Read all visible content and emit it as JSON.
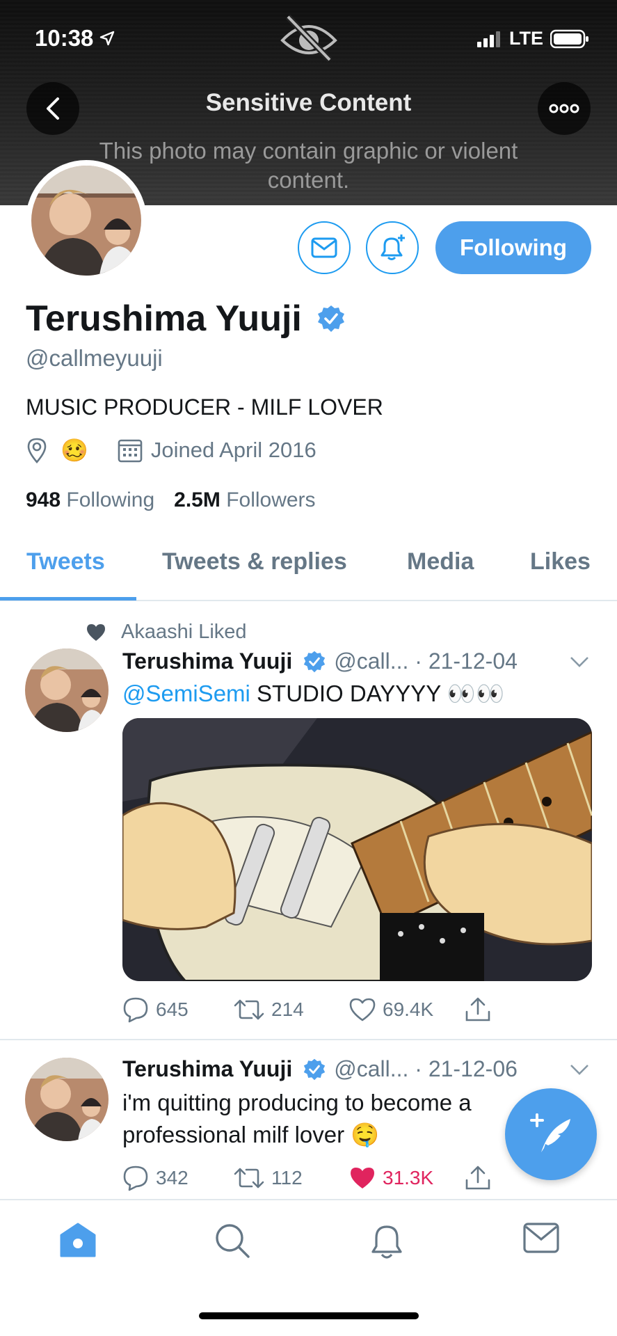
{
  "status_bar": {
    "time": "10:38",
    "network": "LTE"
  },
  "banner": {
    "title": "Sensitive Content",
    "subtitle": "This photo may contain graphic or violent content."
  },
  "profile": {
    "name": "Terushima Yuuji",
    "handle": "@callmeyuuji",
    "bio": "MUSIC PRODUCER - MILF LOVER",
    "location_emoji": "🥴",
    "joined": "Joined April 2016",
    "following_count": "948",
    "following_label": "Following",
    "followers_count": "2.5M",
    "followers_label": "Followers",
    "follow_button": "Following"
  },
  "tabs": [
    "Tweets",
    "Tweets & replies",
    "Media",
    "Likes"
  ],
  "tweets": [
    {
      "context": "Akaashi Liked",
      "name": "Terushima Yuuji",
      "handle_date": "@call... · 21-12-04",
      "mention": "@SemiSemi",
      "text": " STUDIO DAYYYY 👀👀",
      "replies": "645",
      "retweets": "214",
      "likes": "69.4K"
    },
    {
      "name": "Terushima Yuuji",
      "handle_date": "@call... · 21-12-06",
      "text": "i'm quitting producing to become a professional milf lover 🤤",
      "replies": "342",
      "retweets": "112",
      "likes": "31.3K"
    }
  ],
  "colors": {
    "accent": "#4d9fec",
    "like_active": "#e0245e",
    "secondary_text": "#657786"
  },
  "icons": [
    "back-arrow-icon",
    "more-icon",
    "eye-off-icon",
    "mail-icon",
    "bell-plus-icon",
    "verified-badge-icon",
    "location-icon",
    "calendar-icon",
    "heart-icon",
    "reply-icon",
    "retweet-icon",
    "share-icon",
    "chevron-down-icon",
    "compose-icon",
    "home-icon",
    "search-icon",
    "notifications-icon",
    "messages-icon"
  ]
}
